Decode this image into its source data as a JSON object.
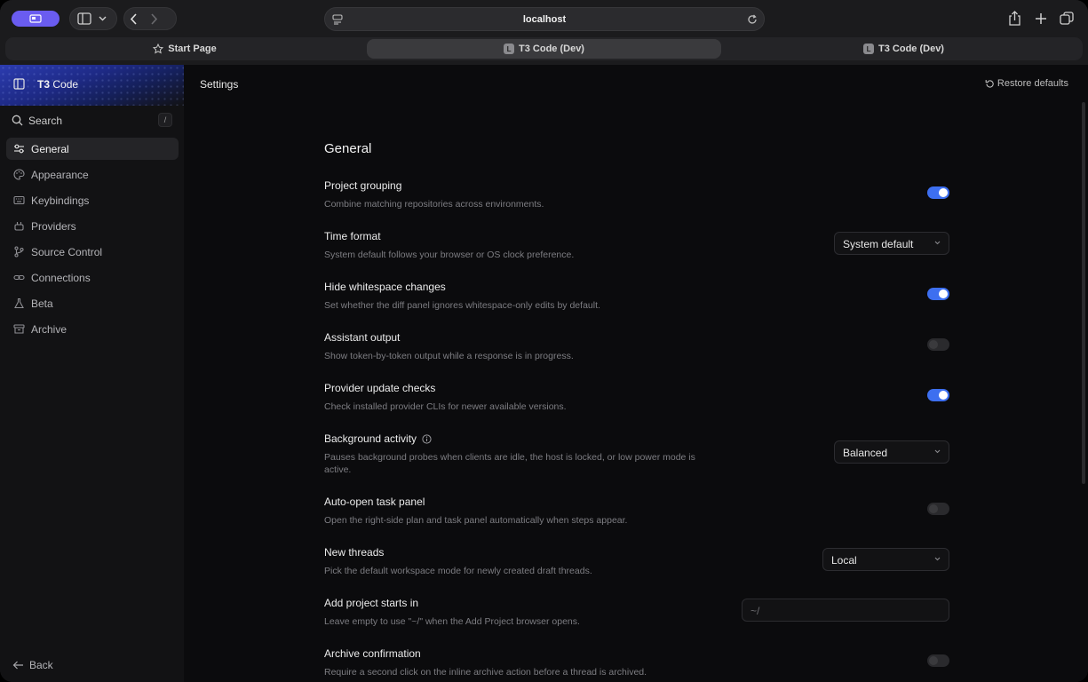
{
  "browser": {
    "url": "localhost",
    "tabs": [
      {
        "label": "Start Page",
        "active": false
      },
      {
        "label": "T3 Code (Dev)",
        "active": true
      },
      {
        "label": "T3 Code (Dev)",
        "active": false
      }
    ],
    "tab_logo_letter": "L",
    "profile_color": "#6a5cf0"
  },
  "sidebar": {
    "app_name_bold": "T3",
    "app_name_rest": " Code",
    "search_label": "Search",
    "search_shortcut": "/",
    "items": [
      {
        "label": "General",
        "icon": "sliders-icon",
        "active": true
      },
      {
        "label": "Appearance",
        "icon": "palette-icon",
        "active": false
      },
      {
        "label": "Keybindings",
        "icon": "keyboard-icon",
        "active": false
      },
      {
        "label": "Providers",
        "icon": "plug-icon",
        "active": false
      },
      {
        "label": "Source Control",
        "icon": "git-branch-icon",
        "active": false
      },
      {
        "label": "Connections",
        "icon": "link-icon",
        "active": false
      },
      {
        "label": "Beta",
        "icon": "flask-icon",
        "active": false
      },
      {
        "label": "Archive",
        "icon": "archive-icon",
        "active": false
      }
    ],
    "back_label": "Back"
  },
  "main": {
    "page_title": "Settings",
    "restore_label": "Restore defaults",
    "section_title": "General",
    "accent_color": "#3d6ff0",
    "settings": [
      {
        "title": "Project grouping",
        "desc": "Combine matching repositories across environments.",
        "control": "toggle",
        "on": true
      },
      {
        "title": "Time format",
        "desc": "System default follows your browser or OS clock preference.",
        "control": "select",
        "value": "System default"
      },
      {
        "title": "Hide whitespace changes",
        "desc": "Set whether the diff panel ignores whitespace-only edits by default.",
        "control": "toggle",
        "on": true
      },
      {
        "title": "Assistant output",
        "desc": "Show token-by-token output while a response is in progress.",
        "control": "toggle",
        "on": false
      },
      {
        "title": "Provider update checks",
        "desc": "Check installed provider CLIs for newer available versions.",
        "control": "toggle",
        "on": true
      },
      {
        "title": "Background activity",
        "desc": "Pauses background probes when clients are idle, the host is locked, or low power mode is active.",
        "control": "select",
        "value": "Balanced",
        "info": true
      },
      {
        "title": "Auto-open task panel",
        "desc": "Open the right-side plan and task panel automatically when steps appear.",
        "control": "toggle",
        "on": false
      },
      {
        "title": "New threads",
        "desc": "Pick the default workspace mode for newly created draft threads.",
        "control": "select",
        "value": "Local"
      },
      {
        "title": "Add project starts in",
        "desc": "Leave empty to use \"~/\" when the Add Project browser opens.",
        "control": "input",
        "placeholder": "~/"
      },
      {
        "title": "Archive confirmation",
        "desc": "Require a second click on the inline archive action before a thread is archived.",
        "control": "toggle",
        "on": false
      }
    ]
  }
}
